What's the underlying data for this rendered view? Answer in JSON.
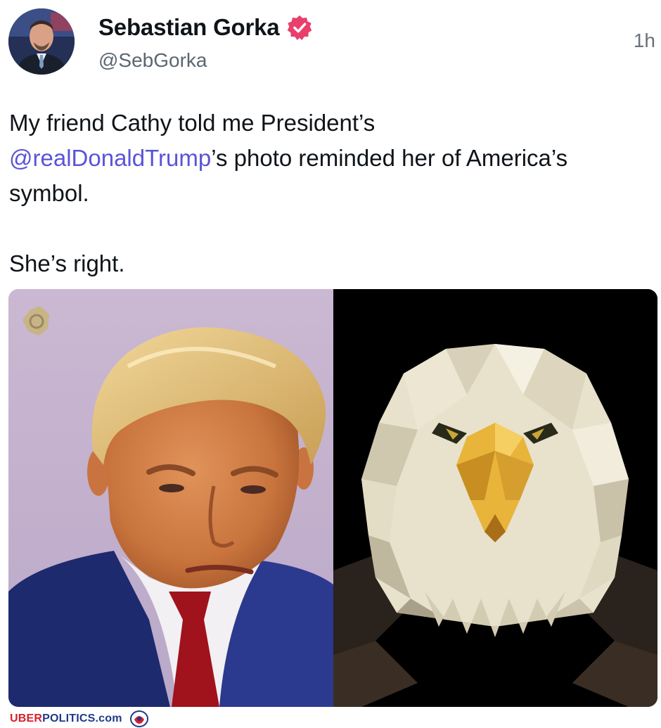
{
  "author": {
    "display_name": "Sebastian Gorka",
    "handle": "@SebGorka",
    "verified": true
  },
  "timestamp": "1h",
  "post": {
    "line1": "My friend Cathy told me President’s",
    "mention": "@realDonaldTrump",
    "line2_rest": "’s photo reminded her of America’s",
    "line3": "symbol.",
    "line4": "She’s right."
  },
  "media": {
    "left_image": "mugshot-photo",
    "right_image": "low-poly-bald-eagle-illustration"
  },
  "watermark": {
    "uber": "UBER",
    "politics": "POLITICS.com"
  },
  "colors": {
    "mention": "#5a54d8",
    "verified_badge": "#e8406b",
    "text": "#0f1419",
    "secondary_text": "#5b6670"
  }
}
